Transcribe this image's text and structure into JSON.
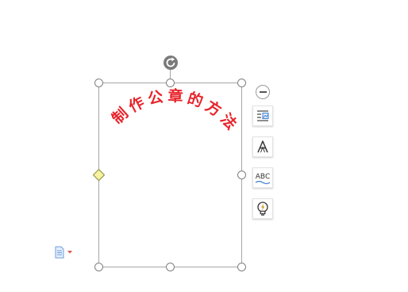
{
  "wordart": {
    "characters": [
      "制",
      "作",
      "公",
      "章",
      "的",
      "方",
      "法"
    ],
    "text_color": "#e8232a"
  },
  "selection": {
    "frame_color": "#a6a6a6",
    "adjust_handle_color": "#f7f3a0",
    "rotate_icon": "rotate-icon"
  },
  "quick_tools": {
    "collapse_icon": "minus-circle-icon",
    "buttons": [
      {
        "name": "layout-options-button",
        "icon": "wrap-text-icon"
      },
      {
        "name": "text-fill-button",
        "icon": "letter-a-icon"
      },
      {
        "name": "text-effects-button",
        "icon": "abc-wave-icon"
      },
      {
        "name": "smart-tools-button",
        "icon": "lightbulb-icon"
      }
    ],
    "abc_label": "ABC"
  },
  "paste_options": {
    "icon": "paste-document-icon"
  }
}
